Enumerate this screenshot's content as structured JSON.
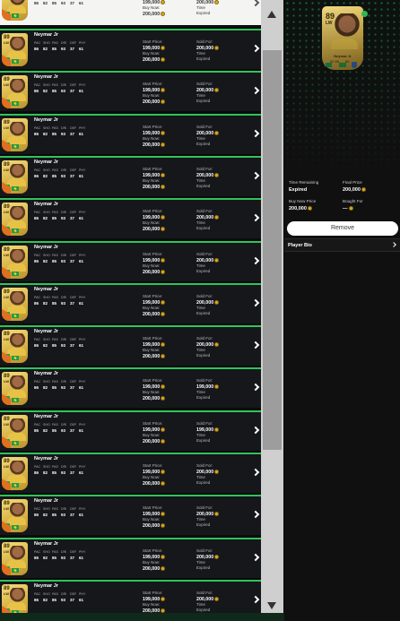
{
  "player": {
    "name": "Neymar Jr",
    "rating": "89",
    "position": "LW",
    "stat_labels": [
      "PAC",
      "SHO",
      "PAS",
      "DRI",
      "DEF",
      "PHY"
    ],
    "stat_values": [
      "86",
      "82",
      "85",
      "93",
      "37",
      "61"
    ]
  },
  "listing_labels": {
    "start_price": "Start Price:",
    "buy_now": "Buy Now:",
    "sold_for": "Sold For:",
    "time": "Time",
    "expired": "Expired"
  },
  "rows": [
    {
      "start": "199,000",
      "buy": "200,000",
      "sold": "200,000",
      "selected": true
    },
    {
      "start": "199,000",
      "buy": "200,000",
      "sold": "200,000"
    },
    {
      "start": "199,000",
      "buy": "200,000",
      "sold": "200,000"
    },
    {
      "start": "199,000",
      "buy": "200,000",
      "sold": "200,000"
    },
    {
      "start": "199,000",
      "buy": "200,000",
      "sold": "200,000"
    },
    {
      "start": "199,000",
      "buy": "200,000",
      "sold": "200,000"
    },
    {
      "start": "199,000",
      "buy": "200,000",
      "sold": "200,000"
    },
    {
      "start": "199,000",
      "buy": "200,000",
      "sold": "200,000"
    },
    {
      "start": "199,000",
      "buy": "200,000",
      "sold": "200,000"
    },
    {
      "start": "199,000",
      "buy": "200,000",
      "sold": "199,000"
    },
    {
      "start": "199,000",
      "buy": "200,000",
      "sold": "199,000"
    },
    {
      "start": "199,000",
      "buy": "200,000",
      "sold": "200,000"
    },
    {
      "start": "199,000",
      "buy": "200,000",
      "sold": "200,000"
    },
    {
      "start": "199,000",
      "buy": "200,000",
      "sold": "200,000"
    },
    {
      "start": "199,000",
      "buy": "200,000",
      "sold": "200,000"
    }
  ],
  "detail": {
    "card_name": "Neymar Jr",
    "card_sub1": "92  85",
    "card_sub2": "89",
    "time_remaining_label": "Time Remaining",
    "time_remaining_value": "Expired",
    "final_price_label": "Final Price",
    "final_price_value": "200,000",
    "buy_now_price_label": "Buy Now Price",
    "buy_now_price_value": "200,000",
    "bought_for_label": "Bought For",
    "bought_for_value": "—",
    "remove_label": "Remove",
    "player_bio_label": "Player Bio"
  },
  "colors": {
    "accent_green": "#2fc45a",
    "gold": "#d8a72b"
  },
  "icons": [
    "coin-icon",
    "chevron-right-icon",
    "scroll-up-icon",
    "scroll-down-icon"
  ]
}
